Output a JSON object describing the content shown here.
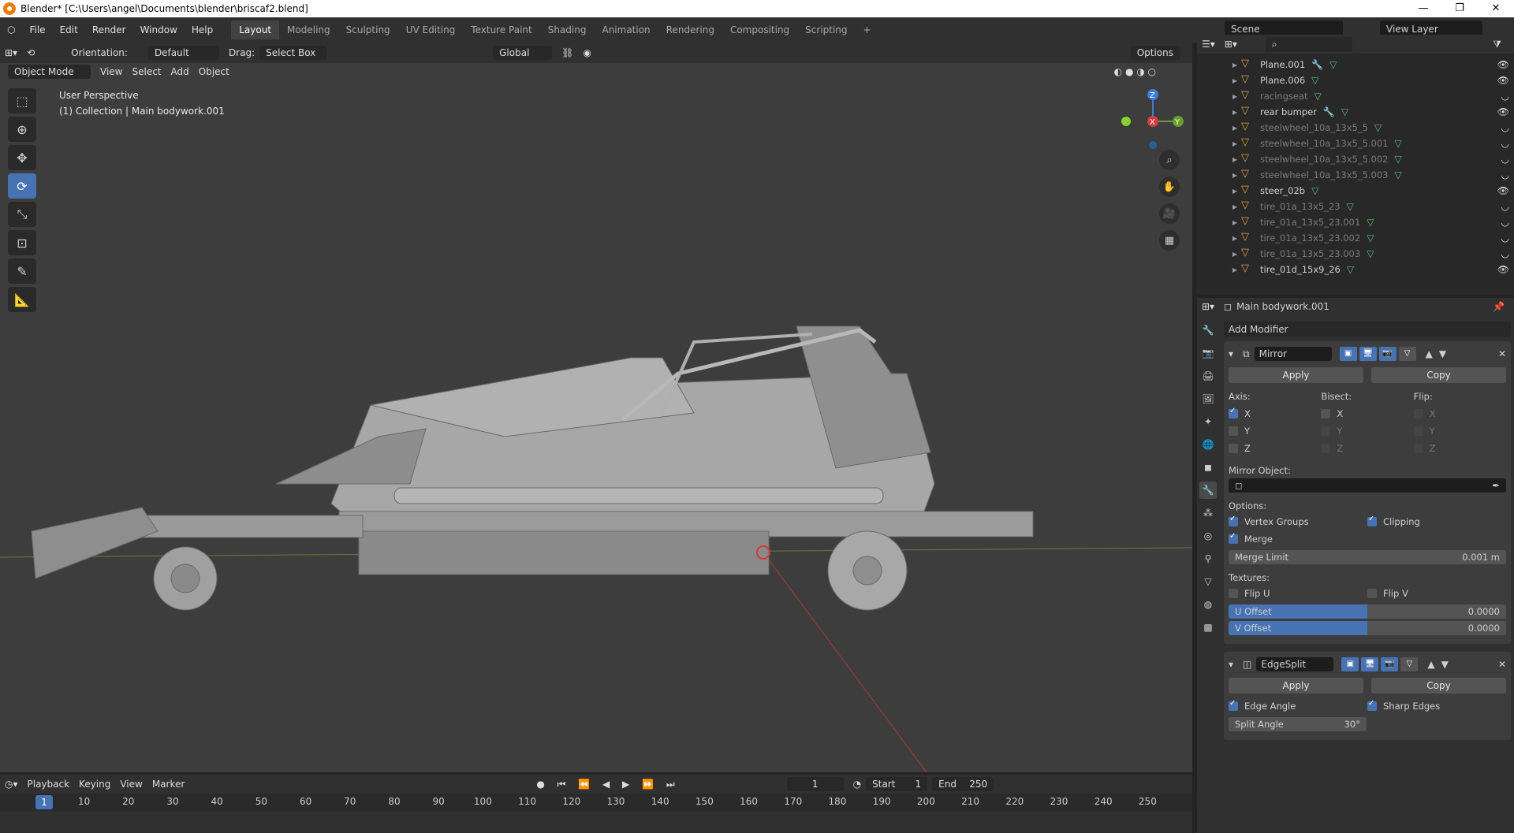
{
  "window": {
    "title": "Blender* [C:\\Users\\angel\\Documents\\blender\\briscaf2.blend]",
    "minimize": "—",
    "maximize": "❐",
    "close": "✕"
  },
  "menu": [
    "File",
    "Edit",
    "Render",
    "Window",
    "Help"
  ],
  "workspaces": [
    "Layout",
    "Modeling",
    "Sculpting",
    "UV Editing",
    "Texture Paint",
    "Shading",
    "Animation",
    "Rendering",
    "Compositing",
    "Scripting",
    "+"
  ],
  "scene": "Scene",
  "view_layer": "View Layer",
  "viewport": {
    "header": {
      "orientation_label": "Orientation:",
      "orientation": "Default",
      "drag_label": "Drag:",
      "drag": "Select Box",
      "transform": "Global",
      "options": "Options"
    },
    "mode": "Object Mode",
    "menus": [
      "View",
      "Select",
      "Add",
      "Object"
    ],
    "info_line1": "User Perspective",
    "info_line2": "(1) Collection | Main bodywork.001",
    "gizmo": {
      "z": "Z",
      "x": "X",
      "y": "Y"
    }
  },
  "timeline": {
    "menus": [
      "Playback",
      "Keying",
      "View",
      "Marker"
    ],
    "current_frame": "1",
    "start_label": "Start",
    "start": "1",
    "end_label": "End",
    "end": "250",
    "ticks": [
      "1",
      "10",
      "20",
      "30",
      "40",
      "50",
      "60",
      "70",
      "80",
      "90",
      "100",
      "110",
      "120",
      "130",
      "140",
      "150",
      "160",
      "170",
      "180",
      "190",
      "200",
      "210",
      "220",
      "230",
      "240",
      "250"
    ]
  },
  "outliner": {
    "items": [
      {
        "name": "Plane.001",
        "visible": true,
        "modifier": true
      },
      {
        "name": "Plane.006",
        "visible": true,
        "modifier": false
      },
      {
        "name": "racingseat",
        "visible": false,
        "modifier": false
      },
      {
        "name": "rear bumper",
        "visible": true,
        "modifier": true
      },
      {
        "name": "steelwheel_10a_13x5_5",
        "visible": false,
        "modifier": false
      },
      {
        "name": "steelwheel_10a_13x5_5.001",
        "visible": false,
        "modifier": false
      },
      {
        "name": "steelwheel_10a_13x5_5.002",
        "visible": false,
        "modifier": false
      },
      {
        "name": "steelwheel_10a_13x5_5.003",
        "visible": false,
        "modifier": false
      },
      {
        "name": "steer_02b",
        "visible": true,
        "modifier": false
      },
      {
        "name": "tire_01a_13x5_23",
        "visible": false,
        "modifier": false
      },
      {
        "name": "tire_01a_13x5_23.001",
        "visible": false,
        "modifier": false
      },
      {
        "name": "tire_01a_13x5_23.002",
        "visible": false,
        "modifier": false
      },
      {
        "name": "tire_01a_13x5_23.003",
        "visible": false,
        "modifier": false
      },
      {
        "name": "tire_01d_15x9_26",
        "visible": true,
        "modifier": false
      }
    ]
  },
  "properties": {
    "object": "Main bodywork.001",
    "add_modifier": "Add Modifier",
    "mirror": {
      "name": "Mirror",
      "apply": "Apply",
      "copy": "Copy",
      "axis": "Axis:",
      "bisect": "Bisect:",
      "flip": "Flip:",
      "x": "X",
      "y": "Y",
      "z": "Z",
      "mirror_object": "Mirror Object:",
      "options": "Options:",
      "vertex_groups": "Vertex Groups",
      "clipping": "Clipping",
      "merge": "Merge",
      "merge_limit_label": "Merge Limit",
      "merge_limit": "0.001 m",
      "textures": "Textures:",
      "flip_u": "Flip U",
      "flip_v": "Flip V",
      "u_offset_label": "U Offset",
      "u_offset": "0.0000",
      "v_offset_label": "V Offset",
      "v_offset": "0.0000"
    },
    "edgesplit": {
      "name": "EdgeSplit",
      "apply": "Apply",
      "copy": "Copy",
      "edge_angle": "Edge Angle",
      "sharp_edges": "Sharp Edges",
      "split_angle_label": "Split Angle",
      "split_angle": "30°"
    }
  }
}
